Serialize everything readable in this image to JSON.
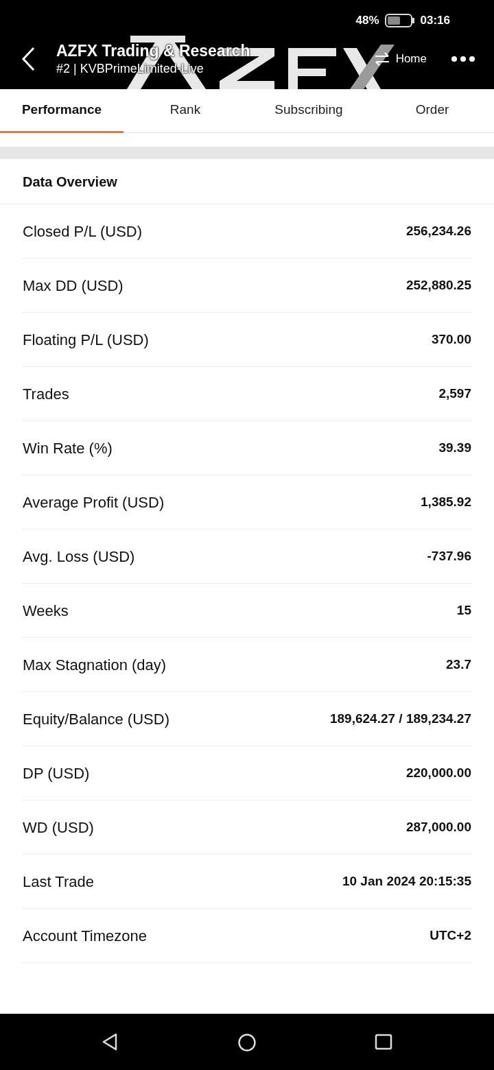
{
  "status_bar": {
    "battery": "48%",
    "time": "03:16"
  },
  "header": {
    "title": "AZFX Trading & Research",
    "subtitle": "#2 | KVBPrimeLimited-Live",
    "switch_label": "Home"
  },
  "tabs": [
    {
      "label": "Performance",
      "selected": true
    },
    {
      "label": "Rank",
      "selected": false
    },
    {
      "label": "Subscribing",
      "selected": false
    },
    {
      "label": "Order",
      "selected": false
    }
  ],
  "section_title": "Data Overview",
  "rows": [
    {
      "label": "Closed P/L (USD)",
      "value": "256,234.26"
    },
    {
      "label": "Max DD (USD)",
      "value": "252,880.25"
    },
    {
      "label": "Floating P/L (USD)",
      "value": "370.00"
    },
    {
      "label": "Trades",
      "value": "2,597"
    },
    {
      "label": "Win Rate (%)",
      "value": "39.39"
    },
    {
      "label": "Average Profit (USD)",
      "value": "1,385.92"
    },
    {
      "label": "Avg. Loss (USD)",
      "value": "-737.96"
    },
    {
      "label": "Weeks",
      "value": "15"
    },
    {
      "label": "Max Stagnation (day)",
      "value": "23.7"
    },
    {
      "label": "Equity/Balance (USD)",
      "value": "189,624.27 / 189,234.27"
    },
    {
      "label": "DP (USD)",
      "value": "220,000.00"
    },
    {
      "label": "WD (USD)",
      "value": "287,000.00"
    },
    {
      "label": "Last Trade",
      "value": "10 Jan 2024 20:15:35"
    },
    {
      "label": "Account Timezone",
      "value": "UTC+2"
    }
  ]
}
